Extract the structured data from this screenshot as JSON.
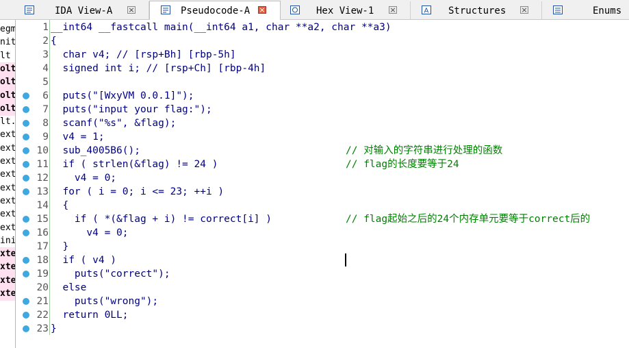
{
  "tabs": [
    {
      "label": "IDA View-A",
      "active": false,
      "icon": "ida-view-icon"
    },
    {
      "label": "Pseudocode-A",
      "active": true,
      "icon": "pseudocode-icon"
    },
    {
      "label": "Hex View-1",
      "active": false,
      "icon": "hex-view-icon"
    },
    {
      "label": "Structures",
      "active": false,
      "icon": "structures-icon"
    },
    {
      "label": "Enums",
      "active": false,
      "icon": "enums-icon"
    }
  ],
  "left_panel": [
    "egm",
    "nit",
    "lt",
    "olt",
    "olt",
    "olt",
    "olt",
    "lt.",
    "ext",
    "ext",
    "ext",
    "ext",
    "ext",
    "ext",
    "ext",
    "ext",
    "ini",
    "xter",
    "xter",
    "xter",
    "xter"
  ],
  "lines": [
    {
      "n": "1",
      "code": "__int64 __fastcall main(__int64 a1, char **a2, char **a3)",
      "comment": "",
      "dot": false
    },
    {
      "n": "2",
      "code": "{",
      "comment": "",
      "dot": false
    },
    {
      "n": "3",
      "code": "  char v4; // [rsp+Bh] [rbp-5h]",
      "comment": "",
      "dot": false
    },
    {
      "n": "4",
      "code": "  signed int i; // [rsp+Ch] [rbp-4h]",
      "comment": "",
      "dot": false
    },
    {
      "n": "5",
      "code": "",
      "comment": "",
      "dot": false
    },
    {
      "n": "6",
      "code": "  puts(\"[WxyVM 0.0.1]\");",
      "comment": "",
      "dot": true
    },
    {
      "n": "7",
      "code": "  puts(\"input your flag:\");",
      "comment": "",
      "dot": true
    },
    {
      "n": "8",
      "code": "  scanf(\"%s\", &flag);",
      "comment": "",
      "dot": true
    },
    {
      "n": "9",
      "code": "  v4 = 1;",
      "comment": "",
      "dot": true
    },
    {
      "n": "10",
      "code": "  sub_4005B6();",
      "comment": "// 对输入的字符串进行处理的函数",
      "dot": true
    },
    {
      "n": "11",
      "code": "  if ( strlen(&flag) != 24 )",
      "comment": "// flag的长度要等于24",
      "dot": true
    },
    {
      "n": "12",
      "code": "    v4 = 0;",
      "comment": "",
      "dot": true
    },
    {
      "n": "13",
      "code": "  for ( i = 0; i <= 23; ++i )",
      "comment": "",
      "dot": true
    },
    {
      "n": "14",
      "code": "  {",
      "comment": "",
      "dot": false
    },
    {
      "n": "15",
      "code": "    if ( *(&flag + i) != correct[i] )",
      "comment": "// flag起始之后的24个内存单元要等于correct后的",
      "dot": true
    },
    {
      "n": "16",
      "code": "      v4 = 0;",
      "comment": "",
      "dot": true
    },
    {
      "n": "17",
      "code": "  }",
      "comment": "",
      "dot": false
    },
    {
      "n": "18",
      "code": "  if ( v4 )",
      "comment": "",
      "dot": true
    },
    {
      "n": "19",
      "code": "    puts(\"correct\");",
      "comment": "",
      "dot": true
    },
    {
      "n": "20",
      "code": "  else",
      "comment": "",
      "dot": false
    },
    {
      "n": "21",
      "code": "    puts(\"wrong\");",
      "comment": "",
      "dot": true
    },
    {
      "n": "22",
      "code": "  return 0LL;",
      "comment": "",
      "dot": true
    },
    {
      "n": "23",
      "code": "}",
      "comment": "",
      "dot": true
    }
  ],
  "colors": {
    "keyword": "#000080",
    "comment": "#008000",
    "dot": "#3fa8e0",
    "highlight": "#ffe0f0"
  }
}
